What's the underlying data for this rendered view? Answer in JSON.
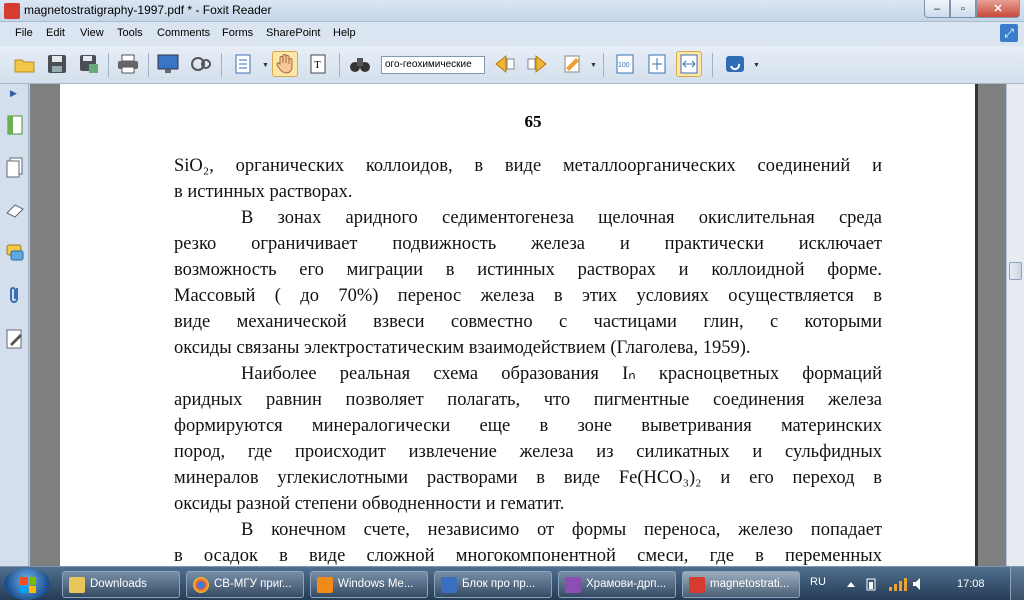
{
  "window": {
    "title": "magnetostratigraphy-1997.pdf * - Foxit Reader",
    "minimize": "–",
    "maximize": "▫",
    "close": "✕"
  },
  "menu": [
    "File",
    "Edit",
    "View",
    "Tools",
    "Comments",
    "Forms",
    "SharePoint",
    "Help"
  ],
  "toolbar": {
    "search_value": "ого-геохимические",
    "buttons": [
      "open-icon",
      "save-icon",
      "save-as-icon",
      "print-icon",
      "screen-icon",
      "find-icon",
      "select-page-icon",
      "hand-tool-icon",
      "select-text-icon",
      "binoculars-icon",
      "prev-result-icon",
      "next-result-icon",
      "highlight-icon",
      "actual-size-icon",
      "fit-page-icon",
      "fit-width-icon",
      "rotate-icon"
    ]
  },
  "document": {
    "page_number": "65",
    "lines": [
      "SiO₂, органических коллоидов, в виде металлоорганических соединений и",
      "в истинных растворах.",
      "В зонах аридного седиментогенеза щелочная окислительная среда",
      "резко ограничивает подвижность железа и практически исключает",
      "возможность его миграции в истинных растворах и коллоидной форме.",
      "Массовый ( до 70%) перенос железа в этих условиях осуществляется в",
      "виде механической взвеси совместно с частицами глин, с которыми",
      "оксиды связаны электростатическим взаимодействием (Глаголева, 1959).",
      "Наиболее реальная схема образования Iₙ красноцветных формаций",
      "аридных равнин позволяет полагать, что пигментные соединения железа",
      "формируются минералогически еще в зоне выветривания материнских",
      "пород, где происходит извлечение железа из силикатных и сульфидных",
      "минералов углекислотными растворами в виде Fe(HCO₃)₂ и его переход в",
      "оксиды разной степени обводненности и гематит.",
      "В конечном счете, независимо от формы переноса, железо попадает",
      "в осадок в виде сложной многокомпонентной смеси, где в переменных"
    ]
  },
  "taskbar": {
    "items": [
      {
        "label": "Downloads",
        "color": "#e7c65a"
      },
      {
        "label": "СВ-МГУ приг...",
        "color": "#e04a3a"
      },
      {
        "label": "Windows Me...",
        "color": "#f08a1a"
      },
      {
        "label": "Блок про пр...",
        "color": "#3a6fc0"
      },
      {
        "label": "Храмови-дрп...",
        "color": "#8a4fb0"
      },
      {
        "label": "magnetostrati...",
        "color": "#d63b2f"
      }
    ],
    "language": "RU",
    "clock": "17:08"
  }
}
